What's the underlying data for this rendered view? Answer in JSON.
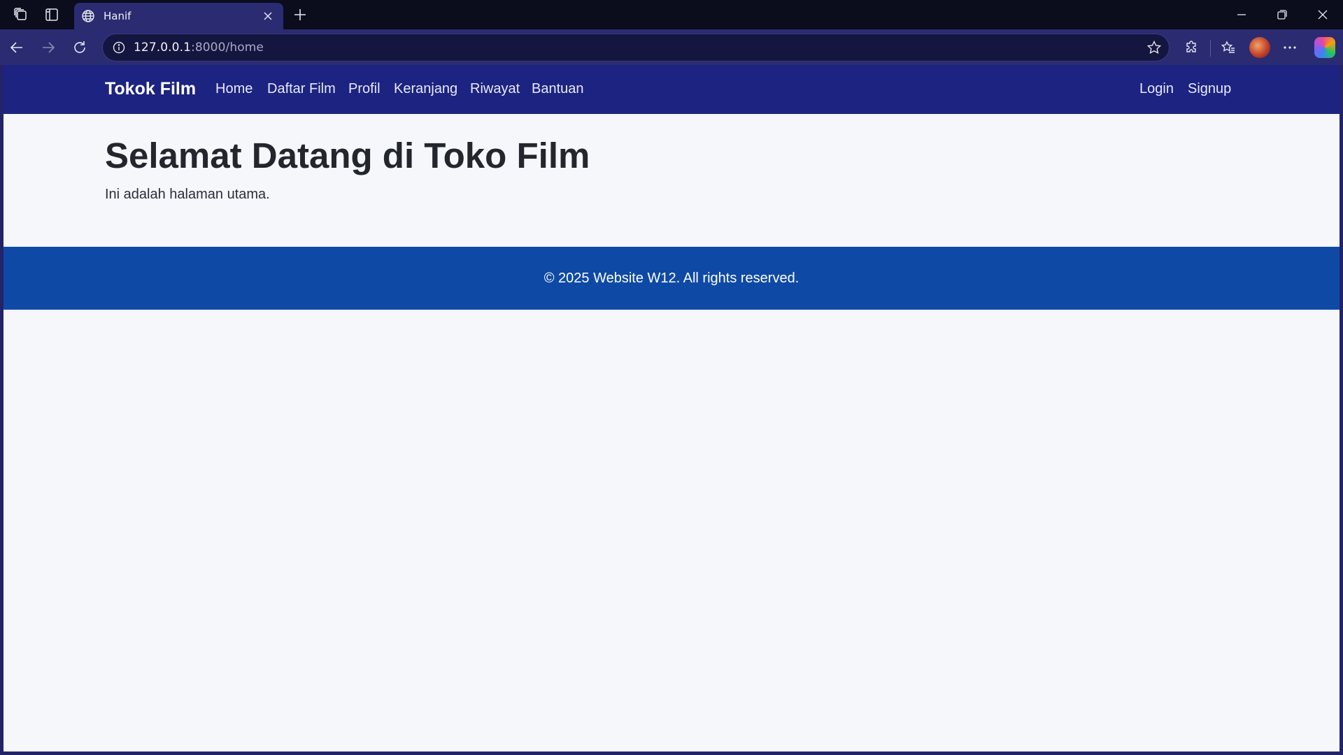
{
  "browser": {
    "tab": {
      "title": "Hanif"
    },
    "url": {
      "host": "127.0.0.1",
      "rest": ":8000/home"
    }
  },
  "site": {
    "brand": "Tokok Film",
    "nav_links": [
      "Home",
      "Daftar Film",
      "Profil",
      "Keranjang",
      "Riwayat",
      "Bantuan"
    ],
    "auth_links": [
      "Login",
      "Signup"
    ]
  },
  "main": {
    "title": "Selamat Datang di Toko Film",
    "subtitle": "Ini adalah halaman utama."
  },
  "footer": {
    "text": "© 2025 Website W12. All rights reserved."
  },
  "colors": {
    "site_nav_bg": "#1c2380",
    "footer_bg": "#0e4aa5",
    "page_bg": "#f5f7fb"
  },
  "icons": {
    "workspaces": "workspaces-icon",
    "vertical_tabs": "vertical-tabs-icon",
    "tab_favicon": "globe-icon",
    "tab_close": "close-icon",
    "new_tab": "plus-icon",
    "back": "back-arrow-icon",
    "forward": "forward-arrow-icon",
    "reload": "reload-icon",
    "site_info": "info-icon",
    "favorite": "star-icon",
    "extensions": "puzzle-icon",
    "favorites": "favorites-list-icon",
    "more": "more-icon"
  }
}
